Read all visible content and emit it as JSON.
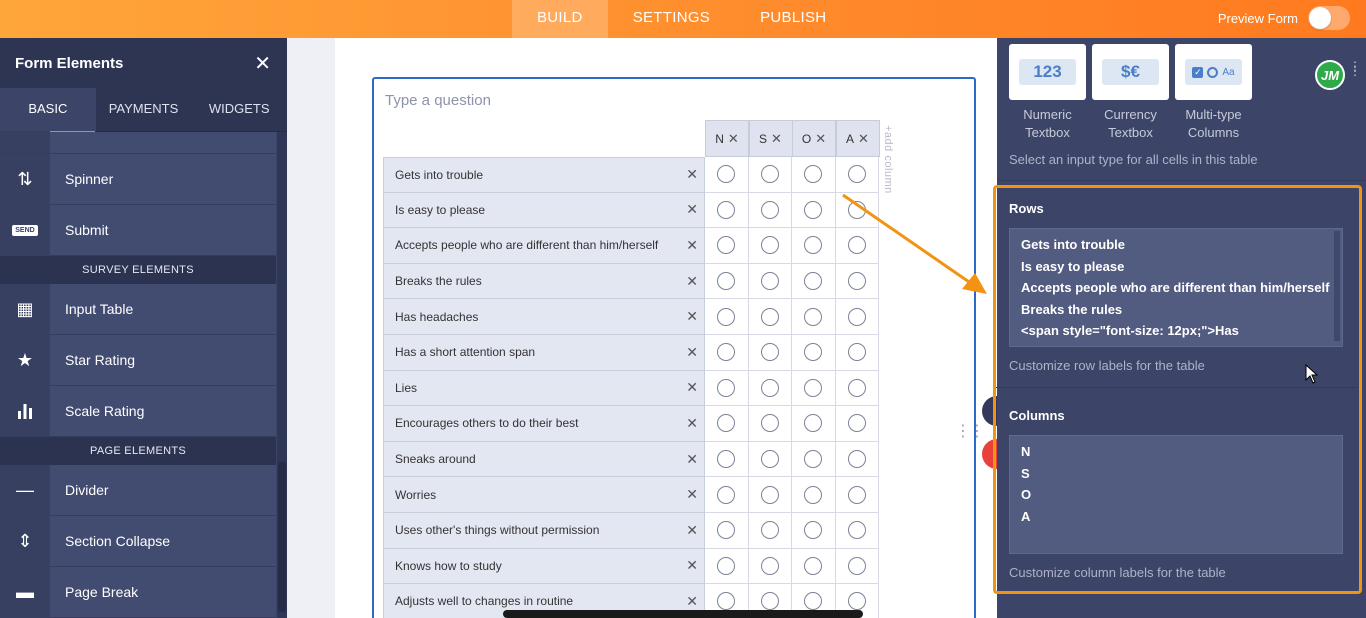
{
  "topbar": {
    "tabs": [
      {
        "label": "BUILD",
        "active": true
      },
      {
        "label": "SETTINGS",
        "active": false
      },
      {
        "label": "PUBLISH",
        "active": false
      }
    ],
    "preview_label": "Preview Form"
  },
  "sidebar": {
    "title": "Form Elements",
    "close_icon": "close-icon",
    "tabs": [
      {
        "label": "BASIC",
        "active": true
      },
      {
        "label": "PAYMENTS",
        "active": false
      },
      {
        "label": "WIDGETS",
        "active": false
      }
    ],
    "items": [
      {
        "label": "Spinner",
        "icon": "spinner-icon",
        "glyph": "⇅"
      },
      {
        "label": "Submit",
        "icon": "submit-icon",
        "glyph": "SEND"
      }
    ],
    "survey_section": "SURVEY ELEMENTS",
    "survey_items": [
      {
        "label": "Input Table",
        "icon": "table-icon",
        "glyph": "▦"
      },
      {
        "label": "Star Rating",
        "icon": "star-icon",
        "glyph": "★"
      },
      {
        "label": "Scale Rating",
        "icon": "bar-chart-icon",
        "glyph": "▮"
      }
    ],
    "page_section": "PAGE ELEMENTS",
    "page_items": [
      {
        "label": "Divider",
        "icon": "divider-icon",
        "glyph": "—"
      },
      {
        "label": "Section Collapse",
        "icon": "section-collapse-icon",
        "glyph": "⇕"
      },
      {
        "label": "Page Break",
        "icon": "page-break-icon",
        "glyph": "▬"
      }
    ]
  },
  "question": {
    "placeholder": "Type a question",
    "add_column": "+add column",
    "columns": [
      "N",
      "S",
      "O",
      "A"
    ],
    "rows": [
      "Gets into trouble",
      "Is easy to please",
      "Accepts people who are different than him/herself",
      "Breaks the rules",
      "Has headaches",
      "Has a short attention span",
      "Lies",
      "Encourages others to do their best",
      "Sneaks around",
      "Worries",
      "Uses other's things without permission",
      "Knows how to study",
      "Adjusts well to changes in routine"
    ]
  },
  "rpanel": {
    "input_types": [
      {
        "label_1": "Numeric",
        "label_2": "Textbox",
        "sample": "123"
      },
      {
        "label_1": "Currency",
        "label_2": "Textbox",
        "sample": "$€"
      },
      {
        "label_1": "Multi-type",
        "label_2": "Columns",
        "sample": "Aa"
      }
    ],
    "input_type_hint": "Select an input type for all cells in this table",
    "rows_title": "Rows",
    "rows_lines": [
      "Gets into trouble",
      "Is easy to please",
      "Accepts people who are different than him/herself",
      "Breaks the rules",
      "<span style=\"font-size: 12px;\">Has"
    ],
    "rows_hint": "Customize row labels for the table",
    "columns_title": "Columns",
    "columns_lines": [
      "N",
      "S",
      "O",
      "A"
    ],
    "columns_hint": "Customize column labels for the table",
    "avatar_initials": "JM"
  },
  "colors": {
    "accent_orange": "#ff8a2b",
    "sidebar_bg": "#3c4467",
    "highlight": "#f39314",
    "selected_border": "#2e69c7"
  }
}
